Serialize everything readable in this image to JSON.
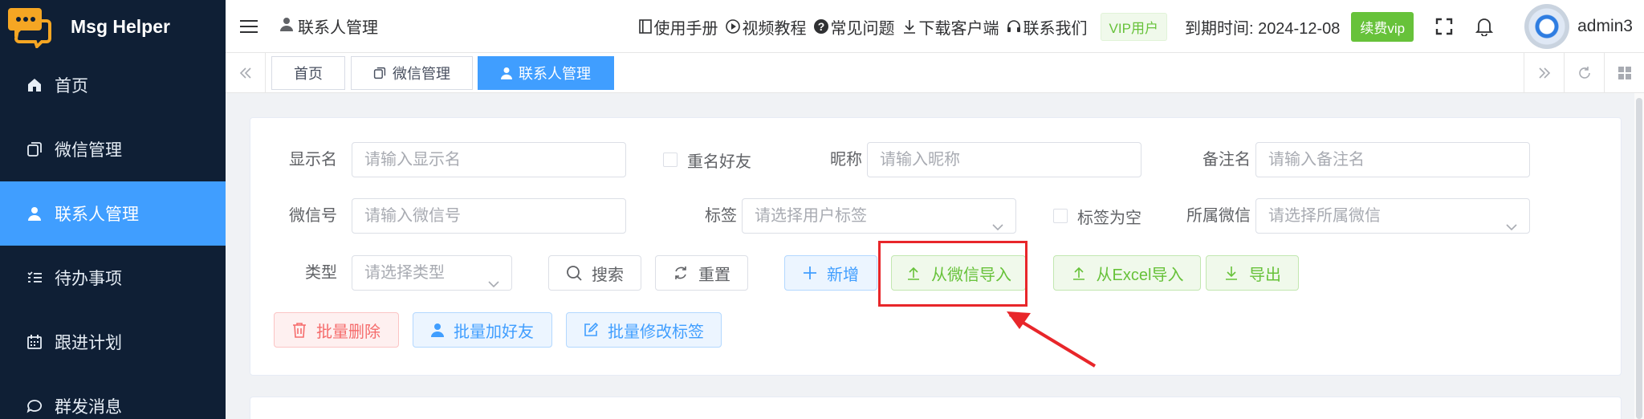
{
  "app": {
    "title": "Msg Helper"
  },
  "sidebar": {
    "items": [
      {
        "label": "首页",
        "icon": "home-icon"
      },
      {
        "label": "微信管理",
        "icon": "copy-icon"
      },
      {
        "label": "联系人管理",
        "icon": "user-icon",
        "active": true
      },
      {
        "label": "待办事项",
        "icon": "list-icon"
      },
      {
        "label": "跟进计划",
        "icon": "calendar-icon"
      },
      {
        "label": "群发消息",
        "icon": "chat-icon"
      }
    ]
  },
  "header": {
    "breadcrumb": "联系人管理",
    "links": {
      "manual": "使用手册",
      "video": "视频教程",
      "faq": "常见问题",
      "download": "下载客户端",
      "contact": "联系我们"
    },
    "vip_tag": "VIP用户",
    "expire_label": "到期时间: 2024-12-08",
    "renew_label": "续费vip",
    "username": "admin3"
  },
  "tabs": [
    {
      "label": "首页"
    },
    {
      "label": "微信管理"
    },
    {
      "label": "联系人管理",
      "active": true
    }
  ],
  "filters": {
    "display_name": {
      "label": "显示名",
      "placeholder": "请输入显示名"
    },
    "duplicate_friend": {
      "label": "重名好友"
    },
    "nickname": {
      "label": "昵称",
      "placeholder": "请输入昵称"
    },
    "remark": {
      "label": "备注名",
      "placeholder": "请输入备注名"
    },
    "wechat_id": {
      "label": "微信号",
      "placeholder": "请输入微信号"
    },
    "tag": {
      "label": "标签",
      "placeholder": "请选择用户标签"
    },
    "tag_empty": {
      "label": "标签为空"
    },
    "owner_wechat": {
      "label": "所属微信",
      "placeholder": "请选择所属微信"
    },
    "type": {
      "label": "类型",
      "placeholder": "请选择类型"
    }
  },
  "buttons": {
    "search": "搜索",
    "reset": "重置",
    "add": "新增",
    "import_wechat": "从微信导入",
    "import_excel": "从Excel导入",
    "export": "导出",
    "batch_delete": "批量删除",
    "batch_add_friend": "批量加好友",
    "batch_edit_tag": "批量修改标签"
  },
  "colors": {
    "sidebar_bg": "#0f1f35",
    "primary": "#409eff",
    "success": "#67c23a",
    "danger": "#f56c6c",
    "highlight": "#e8262a"
  }
}
